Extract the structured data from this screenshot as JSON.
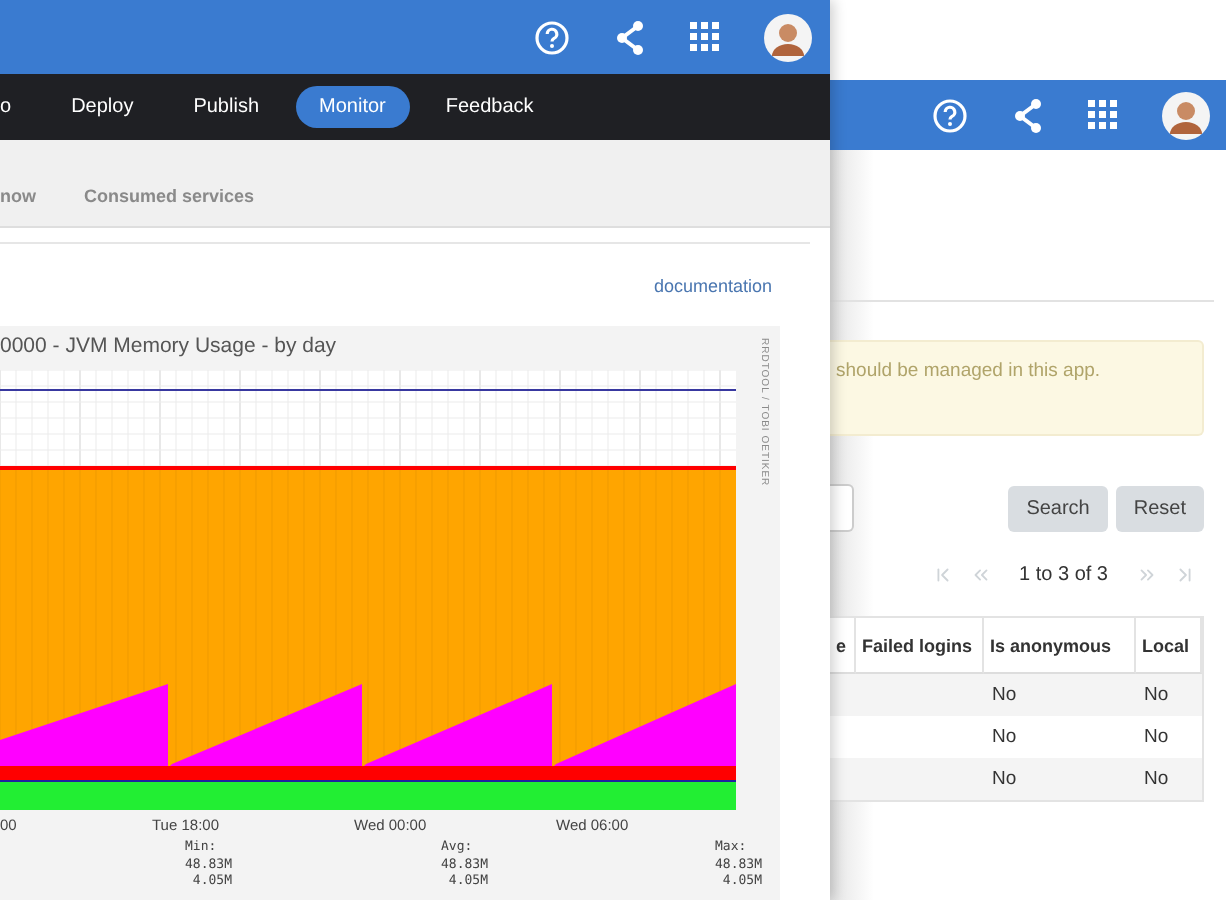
{
  "back_window": {
    "notice": "should be managed in this app.",
    "buttons": [
      {
        "label": "Search"
      },
      {
        "label": "Reset"
      }
    ],
    "pagination": "1 to 3 of 3",
    "table": {
      "columns": [
        "e",
        "Failed logins",
        "Is anonymous",
        "Local"
      ],
      "rows": [
        {
          "is_anonymous": "No",
          "local": "No"
        },
        {
          "is_anonymous": "No",
          "local": "No"
        },
        {
          "is_anonymous": "No",
          "local": "No"
        }
      ]
    }
  },
  "front_window": {
    "nav": [
      {
        "label": "o",
        "selected": false
      },
      {
        "label": "Deploy",
        "selected": false
      },
      {
        "label": "Publish",
        "selected": false
      },
      {
        "label": "Monitor",
        "selected": true
      },
      {
        "label": "Feedback",
        "selected": false
      }
    ],
    "tabs": [
      {
        "label": "now",
        "selected": false
      },
      {
        "label": "Consumed services",
        "selected": false
      }
    ],
    "documentation_link": "documentation",
    "chart": {
      "title": "0000 - JVM Memory Usage - by day",
      "side_text": "RRDTOOL / TOBI OETIKER",
      "x_labels": [
        "00",
        "Tue 18:00",
        "Wed 00:00",
        "Wed 06:00"
      ],
      "stats": [
        {
          "label": "Min:",
          "values": [
            "48.83M",
            "4.05M"
          ]
        },
        {
          "label": "Avg:",
          "values": [
            "48.83M",
            "4.05M"
          ]
        },
        {
          "label": "Max:",
          "values": [
            "48.83M",
            "4.05M"
          ]
        }
      ]
    }
  }
}
